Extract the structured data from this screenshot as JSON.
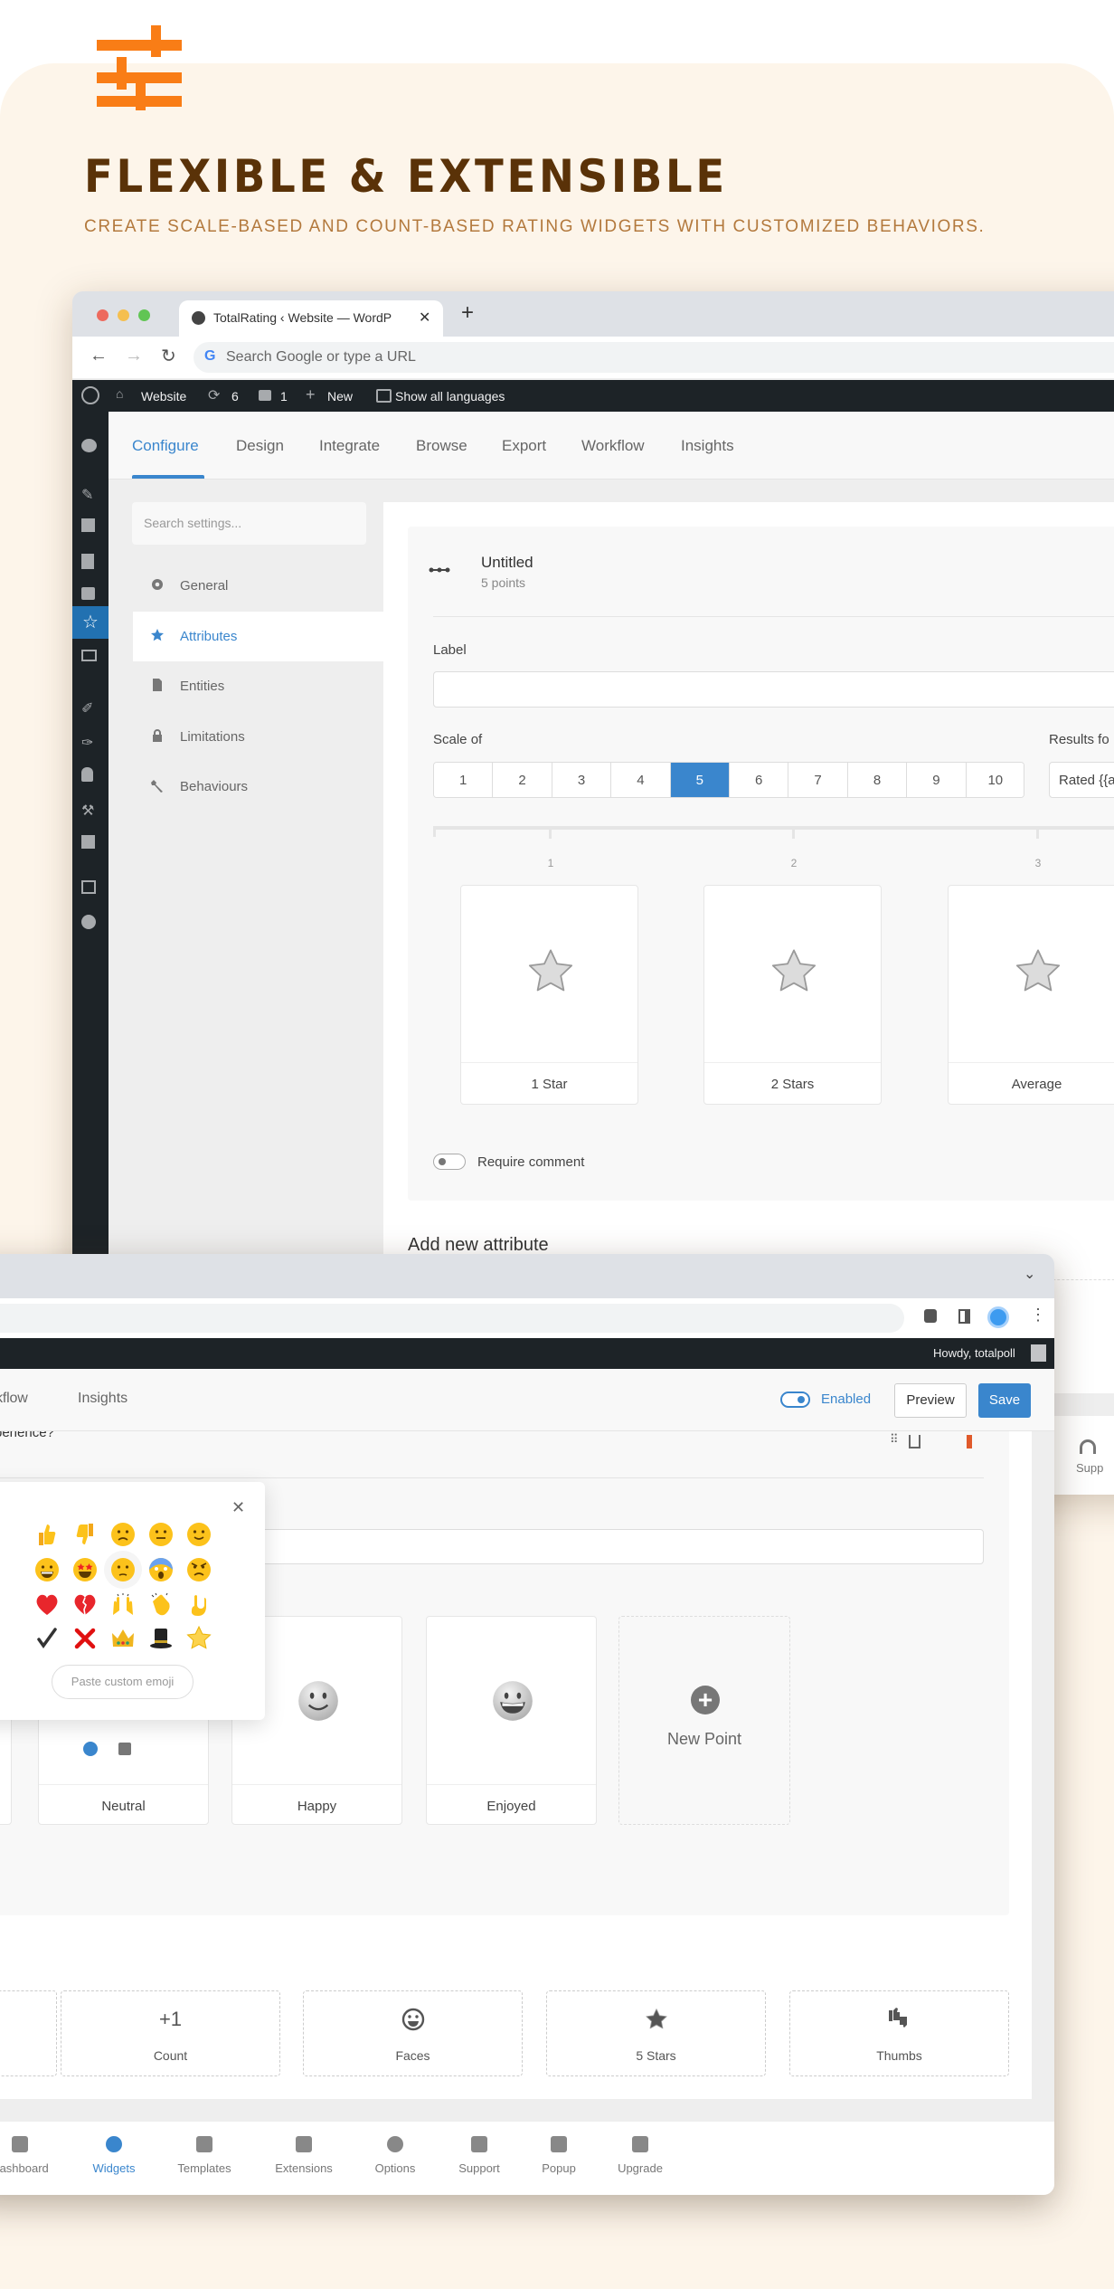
{
  "hero": {
    "title": "FLEXIBLE & EXTENSIBLE",
    "subtitle": "CREATE SCALE-BASED AND COUNT-BASED RATING WIDGETS WITH CUSTOMIZED BEHAVIORS.",
    "logo_icon": "sliders-icon",
    "accent": "#f97d16"
  },
  "colors": {
    "accent": "#3a86cd",
    "title": "#5a3208",
    "subtitle": "#b3793d",
    "danger": "#e05a2b"
  },
  "window1": {
    "browser_tab_title": "TotalRating ‹ Website — WordP",
    "address_placeholder": "Search Google or type a URL",
    "admin_bar": {
      "site": "Website",
      "updates": "6",
      "comments": "1",
      "new": "New",
      "languages": "Show all languages"
    },
    "tabs": [
      "Configure",
      "Design",
      "Integrate",
      "Browse",
      "Export",
      "Workflow",
      "Insights"
    ],
    "active_tab": "Configure",
    "settings_search_placeholder": "Search settings...",
    "settings_nav": [
      {
        "label": "General",
        "icon": "gear-icon"
      },
      {
        "label": "Attributes",
        "icon": "star-icon",
        "active": true
      },
      {
        "label": "Entities",
        "icon": "document-icon"
      },
      {
        "label": "Limitations",
        "icon": "lock-icon"
      },
      {
        "label": "Behaviours",
        "icon": "wrench-icon"
      }
    ],
    "attribute": {
      "title": "Untitled",
      "subtitle": "5 points"
    },
    "label_field": {
      "label": "Label",
      "value": ""
    },
    "scale": {
      "label": "Scale of",
      "options": [
        "1",
        "2",
        "3",
        "4",
        "5",
        "6",
        "7",
        "8",
        "9",
        "10"
      ],
      "selected": "5"
    },
    "results": {
      "label": "Results fo",
      "value": "Rated {{a"
    },
    "slider_ticks": [
      "1",
      "2",
      "3"
    ],
    "points": [
      {
        "label": "1 Star",
        "icon": "star"
      },
      {
        "label": "2 Stars",
        "icon": "star"
      },
      {
        "label": "Average",
        "icon": "star"
      }
    ],
    "require_comment": {
      "label": "Require comment",
      "on": false
    },
    "add_new_attribute": "Add new attribute",
    "bottom_nav_partial": "Supp"
  },
  "window2": {
    "admin_bar": {
      "howdy": "Howdy, totalpoll"
    },
    "tabs": [
      "rkflow",
      "Insights"
    ],
    "enabled": {
      "label": "Enabled",
      "on": true
    },
    "preview": "Preview",
    "save": "Save",
    "question_partial": "perience?",
    "emoji_picker": {
      "emojis": [
        "thumbs-up",
        "thumbs-down",
        "slightly-frowning-face",
        "neutral-face",
        "slightly-smiling-face",
        "grinning-face",
        "star-struck",
        "unamused-face",
        "screaming-face",
        "angry-face",
        "red-heart",
        "broken-heart",
        "raised-hands",
        "clapping-hands",
        "ok-hand",
        "check-mark",
        "cross-mark",
        "crown",
        "top-hat",
        "star"
      ],
      "selected": "unamused-face",
      "paste_placeholder": "Paste custom emoji"
    },
    "points": [
      {
        "label": "Neutral"
      },
      {
        "label": "Happy",
        "icon": "smiling-face"
      },
      {
        "label": "Enjoyed",
        "icon": "grinning-face"
      }
    ],
    "new_point": "New Point",
    "templates": [
      {
        "label": "Count",
        "icon": "+1"
      },
      {
        "label": "Faces",
        "icon": "face-icon"
      },
      {
        "label": "5 Stars",
        "icon": "star-icon"
      },
      {
        "label": "Thumbs",
        "icon": "thumbs-icon"
      }
    ],
    "bottom_nav": [
      {
        "label": "Dashboard",
        "icon": "dashboard-icon"
      },
      {
        "label": "Widgets",
        "icon": "widgets-icon",
        "active": true
      },
      {
        "label": "Templates",
        "icon": "templates-icon"
      },
      {
        "label": "Extensions",
        "icon": "puzzle-icon"
      },
      {
        "label": "Options",
        "icon": "gear-icon"
      },
      {
        "label": "Support",
        "icon": "headphones-icon"
      },
      {
        "label": "Popup",
        "icon": "popup-icon"
      },
      {
        "label": "Upgrade",
        "icon": "upgrade-icon"
      }
    ]
  }
}
